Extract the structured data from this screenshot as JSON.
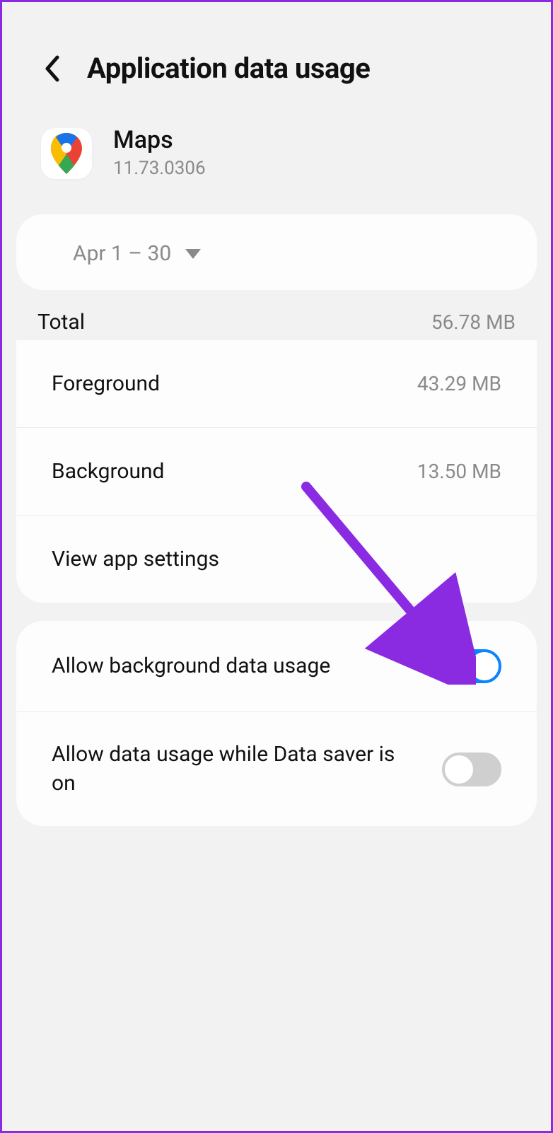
{
  "header": {
    "title": "Application data usage"
  },
  "app": {
    "name": "Maps",
    "version": "11.73.0306"
  },
  "dateRange": "Apr 1 – 30",
  "usage": {
    "totalLabel": "Total",
    "totalValue": "56.78 MB",
    "foregroundLabel": "Foreground",
    "foregroundValue": "43.29 MB",
    "backgroundLabel": "Background",
    "backgroundValue": "13.50 MB",
    "viewSettingsLabel": "View app settings"
  },
  "toggles": {
    "bgDataLabel": "Allow background data usage",
    "bgDataOn": true,
    "dataSaverLabel": "Allow data usage while Data saver is on",
    "dataSaverOn": false
  }
}
